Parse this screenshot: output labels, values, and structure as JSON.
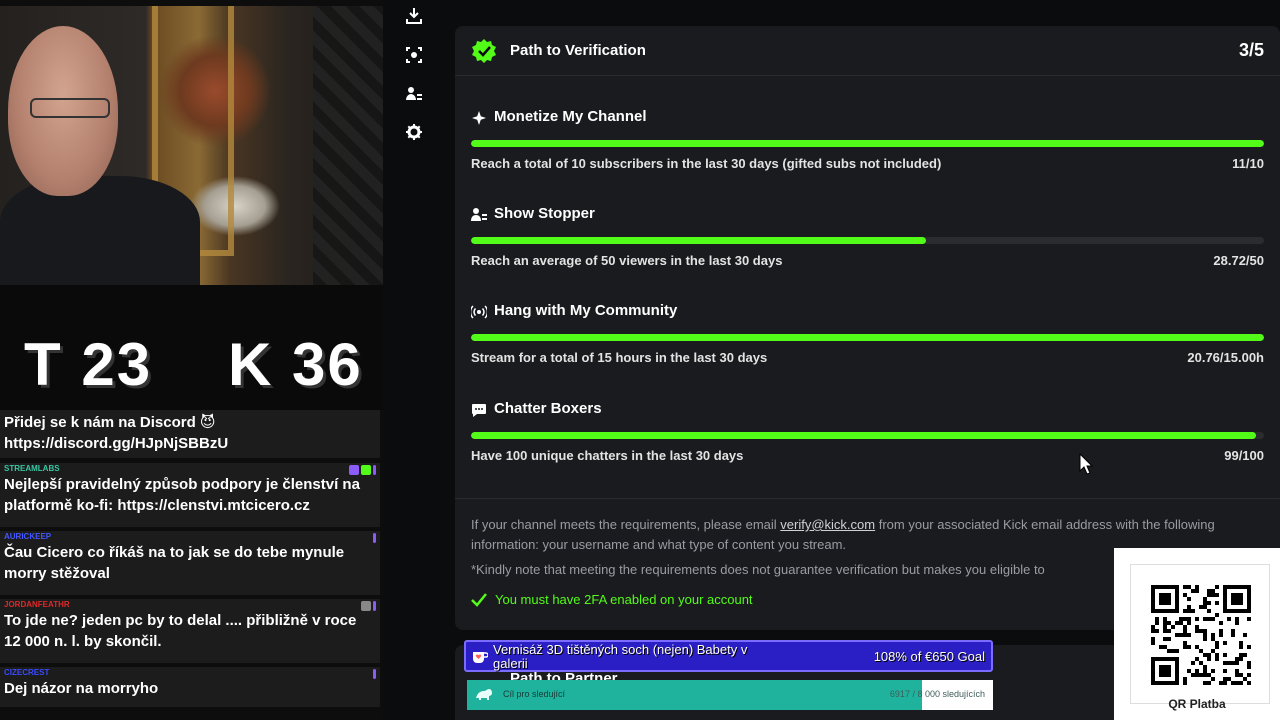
{
  "colors": {
    "accent": "#53fc18",
    "panel_bg": "#1a1b1e",
    "goal_bg": "#2a1fc4",
    "follow_fill": "#1fb39e"
  },
  "scoreboard": {
    "left": "T 23",
    "right": "K 36"
  },
  "chat": [
    {
      "user": "",
      "text": "Přidej se k nám na Discord 😈 https://discord.gg/HJpNjSBBzU",
      "user_color": "#ffffff"
    },
    {
      "user": "STREAMLABS",
      "text": "Nejlepší pravidelný způsob podpory je členství na platformě ko-fi: https://clenstvi.mtcicero.cz",
      "user_color": "#37c7a3"
    },
    {
      "user": "AURICKEEP",
      "text": "Čau Cicero co říkáš na to jak se do tebe mynule morry stěžoval",
      "user_color": "#4455ff"
    },
    {
      "user": "JORDANFEATHR",
      "text": "To jde ne? jeden pc by to delal .... přibližně v roce 12 000 n. l. by skončil.",
      "user_color": "#e02828"
    },
    {
      "user": "CIZECREST",
      "text": "Dej názor na morryho",
      "user_color": "#3a4bff"
    }
  ],
  "rail": {
    "icons": [
      "download-icon",
      "screen-capture-icon",
      "user-settings-icon",
      "gear-icon"
    ]
  },
  "panel": {
    "title": "Path to Verification",
    "count": "3/5",
    "requirements": [
      {
        "title": "Monetize My Channel",
        "icon": "sparkle-icon",
        "desc": "Reach a total of 10 subscribers in the last 30 days (gifted subs not included)",
        "value": "11/10",
        "progress": 1.0
      },
      {
        "title": "Show Stopper",
        "icon": "users-icon",
        "desc": "Reach an average of 50 viewers in the last 30 days",
        "value": "28.72/50",
        "progress": 0.5744
      },
      {
        "title": "Hang with My Community",
        "icon": "broadcast-icon",
        "desc": "Stream for a total of 15 hours in the last 30 days",
        "value": "20.76/15.00h",
        "progress": 1.0
      },
      {
        "title": "Chatter Boxers",
        "icon": "chat-bubble-icon",
        "desc": "Have 100 unique chatters in the last 30 days",
        "value": "99/100",
        "progress": 0.99
      }
    ],
    "info_before": "If your channel meets the requirements, please email ",
    "info_email": "verify@kick.com",
    "info_after": " from your associated Kick email address with the following information: your username and what type of content you stream.",
    "note": "*Kindly note that meeting the requirements does not guarantee verification but makes you eligible to",
    "twofa": "You must have 2FA enabled on your account"
  },
  "panel2": {
    "title": "Path to Partner"
  },
  "goal": {
    "title": "Vernisáž 3D tištěných soch (nejen) Babety v galerii",
    "percent": "108% of €650 Goal"
  },
  "follow_goal": {
    "label": "Cíl pro sledující",
    "count": "6917 / 8 000 sledujících",
    "progress": 0.8646
  },
  "qr": {
    "label": "QR Platba"
  }
}
